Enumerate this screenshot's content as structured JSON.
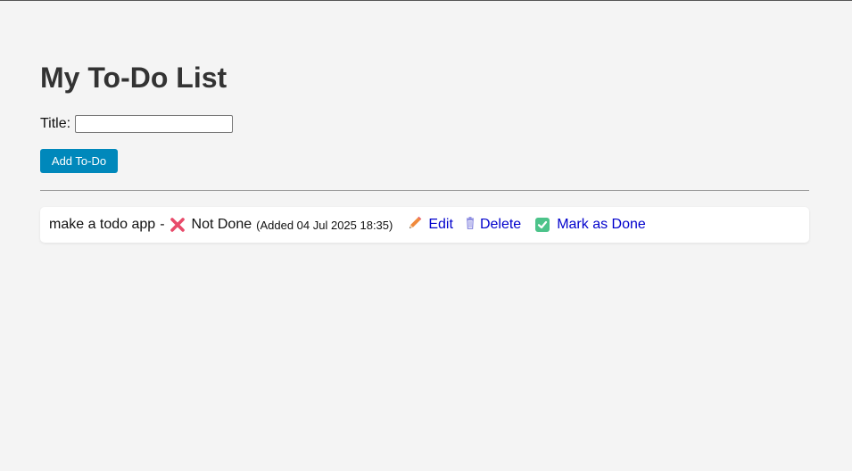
{
  "page": {
    "title": "My To-Do List"
  },
  "form": {
    "title_label": "Title:",
    "title_value": "",
    "add_button_label": "Add To-Do"
  },
  "todos": [
    {
      "text": "make a todo app",
      "separator": "-",
      "status": "Not Done",
      "status_icon": "cross-mark-icon",
      "added": "(Added 04 Jul 2025 18:35)",
      "actions": {
        "edit": "Edit",
        "delete": "Delete",
        "mark_done": "Mark as Done"
      }
    }
  ],
  "colors": {
    "background": "#f4f4f4",
    "button": "#0088bb",
    "link": "#0000cc",
    "cross": "#e84a6a",
    "check": "#4cc38a"
  }
}
